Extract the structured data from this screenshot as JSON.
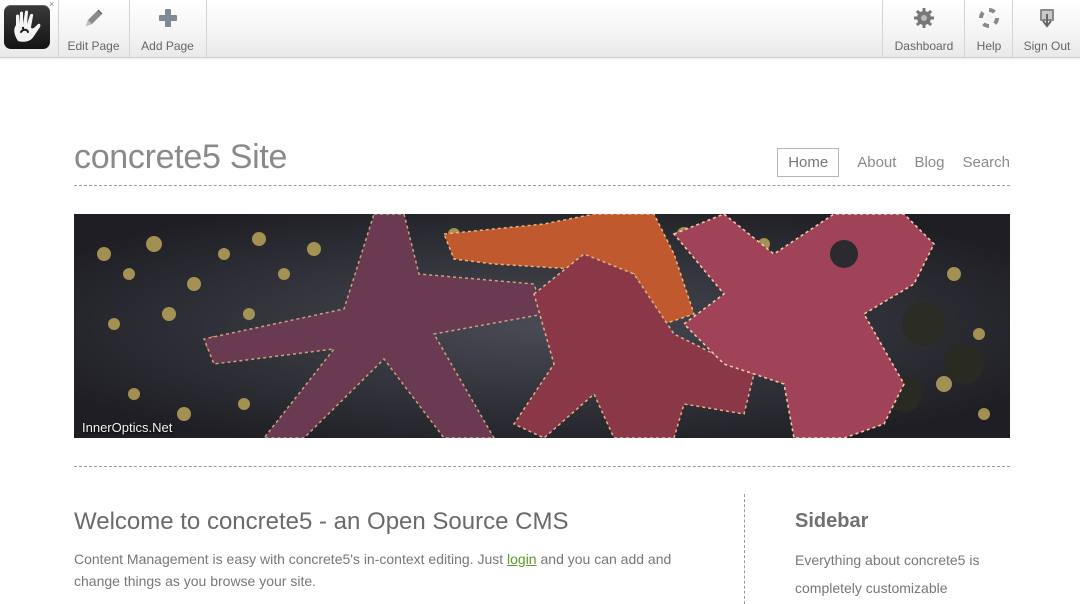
{
  "toolbar": {
    "close_glyph": "×",
    "items_left": [
      {
        "label": "Edit Page",
        "icon": "pencil-icon"
      },
      {
        "label": "Add Page",
        "icon": "plus-icon"
      }
    ],
    "items_right": [
      {
        "label": "Dashboard",
        "icon": "gear-icon"
      },
      {
        "label": "Help",
        "icon": "lifebuoy-icon"
      },
      {
        "label": "Sign Out",
        "icon": "sign-out-icon"
      }
    ]
  },
  "site": {
    "title": "concrete5 Site",
    "nav": [
      "Home",
      "About",
      "Blog",
      "Search"
    ],
    "hero_credit": "InnerOptics.Net"
  },
  "main": {
    "heading": "Welcome to concrete5 - an Open Source CMS",
    "body_before": "Content Management is easy with concrete5's in-context editing. Just ",
    "link": "login",
    "body_after": " and you can add and change things as you browse your site."
  },
  "sidebar": {
    "heading": "Sidebar",
    "body": "Everything about concrete5 is completely customizable"
  },
  "colors": {
    "link": "#5a9a2a",
    "title": "#8a8a8a"
  }
}
